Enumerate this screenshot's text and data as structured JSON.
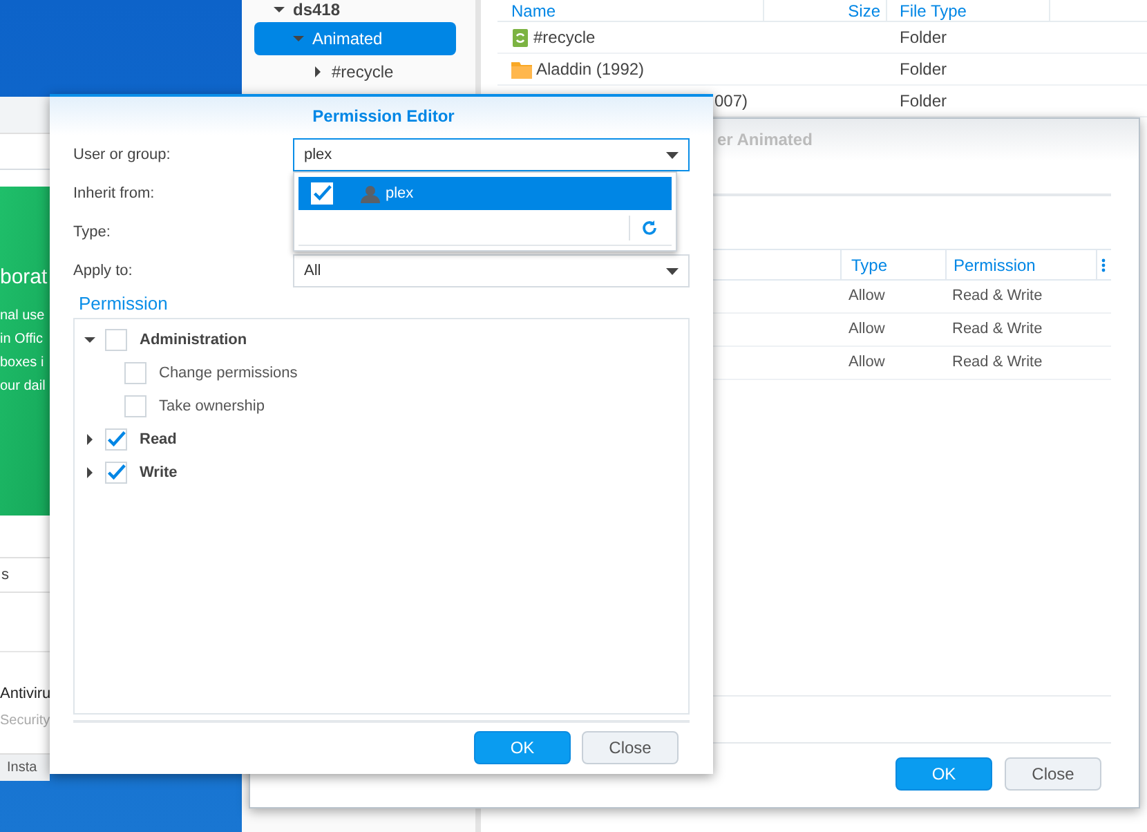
{
  "package_center": {
    "banner_lines": [
      "borat",
      "nal use",
      "in Offic",
      "boxes i",
      "our dail"
    ],
    "tab": "s",
    "app_name": "Antiviru",
    "app_category": "Security",
    "button": "Insta"
  },
  "file_station": {
    "tree": [
      {
        "label": "ds418",
        "expanded": true,
        "selected": false,
        "children": [
          {
            "label": "Animated",
            "expanded": true,
            "selected": true,
            "children": [
              {
                "label": "#recycle",
                "expanded": false,
                "selected": false
              }
            ]
          }
        ]
      }
    ],
    "columns": [
      "Name",
      "Size",
      "File Type"
    ],
    "files": [
      {
        "name": "#recycle",
        "kind": "recycle",
        "type": "Folder"
      },
      {
        "name": "Aladdin (1992)",
        "kind": "folder",
        "type": "Folder"
      },
      {
        "name": "007)",
        "kind": "covered",
        "type": "Folder"
      }
    ]
  },
  "properties_window": {
    "title": "er Animated",
    "columns": [
      "Type",
      "Permission"
    ],
    "rows": [
      {
        "type": "Allow",
        "permission": "Read & Write"
      },
      {
        "type": "Allow",
        "permission": "Read & Write"
      },
      {
        "type": "Allow",
        "permission": "Read & Write"
      }
    ],
    "buttons": [
      {
        "label": "OK",
        "kind": "primary"
      },
      {
        "label": "Close",
        "kind": "secondary"
      }
    ]
  },
  "permission_editor": {
    "title": "Permission Editor",
    "fields": [
      {
        "label": "User or group:",
        "value": "plex",
        "focused": true
      },
      {
        "label": "Inherit from:"
      },
      {
        "label": "Type:"
      },
      {
        "label": "Apply to:",
        "value": "All",
        "focused": false
      }
    ],
    "dropdown": {
      "options": [
        {
          "label": "plex",
          "checked": true,
          "selected": true
        }
      ]
    },
    "section": "Permission",
    "permissions": [
      {
        "label": "Administration",
        "checked": false,
        "expanded": true,
        "children": [
          {
            "label": "Change permissions",
            "checked": false
          },
          {
            "label": "Take ownership",
            "checked": false
          }
        ]
      },
      {
        "label": "Read",
        "checked": true,
        "expanded": false
      },
      {
        "label": "Write",
        "checked": true,
        "expanded": false
      }
    ],
    "buttons": [
      {
        "label": "OK",
        "kind": "primary"
      },
      {
        "label": "Close",
        "kind": "secondary"
      }
    ]
  }
}
